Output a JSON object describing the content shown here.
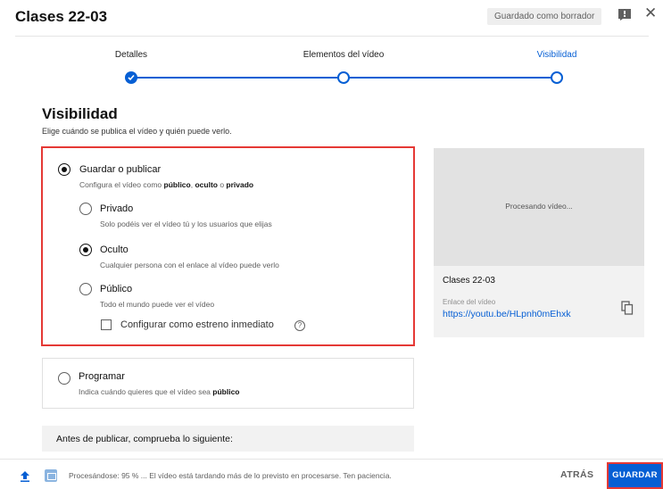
{
  "header": {
    "title": "Clases 22-03",
    "draft_badge": "Guardado como borrador"
  },
  "stepper": {
    "steps": [
      {
        "label": "Detalles",
        "state": "done"
      },
      {
        "label": "Elementos del vídeo",
        "state": "pending"
      },
      {
        "label": "Visibilidad",
        "state": "active"
      }
    ]
  },
  "visibility": {
    "title": "Visibilidad",
    "subtitle": "Elige cuándo se publica el vídeo y quién puede verlo.",
    "save_publish": {
      "label": "Guardar o publicar",
      "desc_prefix": "Configura el vídeo como ",
      "desc_public": "público",
      "desc_sep1": ", ",
      "desc_hidden": "oculto",
      "desc_sep2": " o ",
      "desc_private": "privado",
      "selected": true
    },
    "options": {
      "private": {
        "label": "Privado",
        "desc": "Solo podéis ver el vídeo tú y los usuarios que elijas",
        "selected": false
      },
      "hidden": {
        "label": "Oculto",
        "desc": "Cualquier persona con el enlace al vídeo puede verlo",
        "selected": true
      },
      "public": {
        "label": "Público",
        "desc": "Todo el mundo puede ver el vídeo",
        "selected": false
      }
    },
    "premiere": {
      "label": "Configurar como estreno inmediato",
      "checked": false,
      "help": "?"
    },
    "schedule": {
      "label": "Programar",
      "desc_prefix": "Indica cuándo quieres que el vídeo sea ",
      "desc_bold": "público"
    },
    "checklist_title": "Antes de publicar, comprueba lo siguiente:"
  },
  "preview": {
    "processing_text": "Procesando vídeo...",
    "video_title": "Clases 22-03",
    "link_label": "Enlace del vídeo",
    "link": "https://youtu.be/HLpnh0mEhxk"
  },
  "footer": {
    "status": "Procesándose: 95 % ... El vídeo está tardando más de lo previsto en procesarse. Ten paciencia.",
    "back_label": "ATRÁS",
    "save_label": "GUARDAR"
  },
  "colors": {
    "accent": "#065fd4",
    "highlight": "#e53935"
  },
  "icons": [
    "feedback-icon",
    "close-icon",
    "check-icon",
    "help-icon",
    "copy-icon",
    "upload-icon",
    "hd-icon"
  ]
}
